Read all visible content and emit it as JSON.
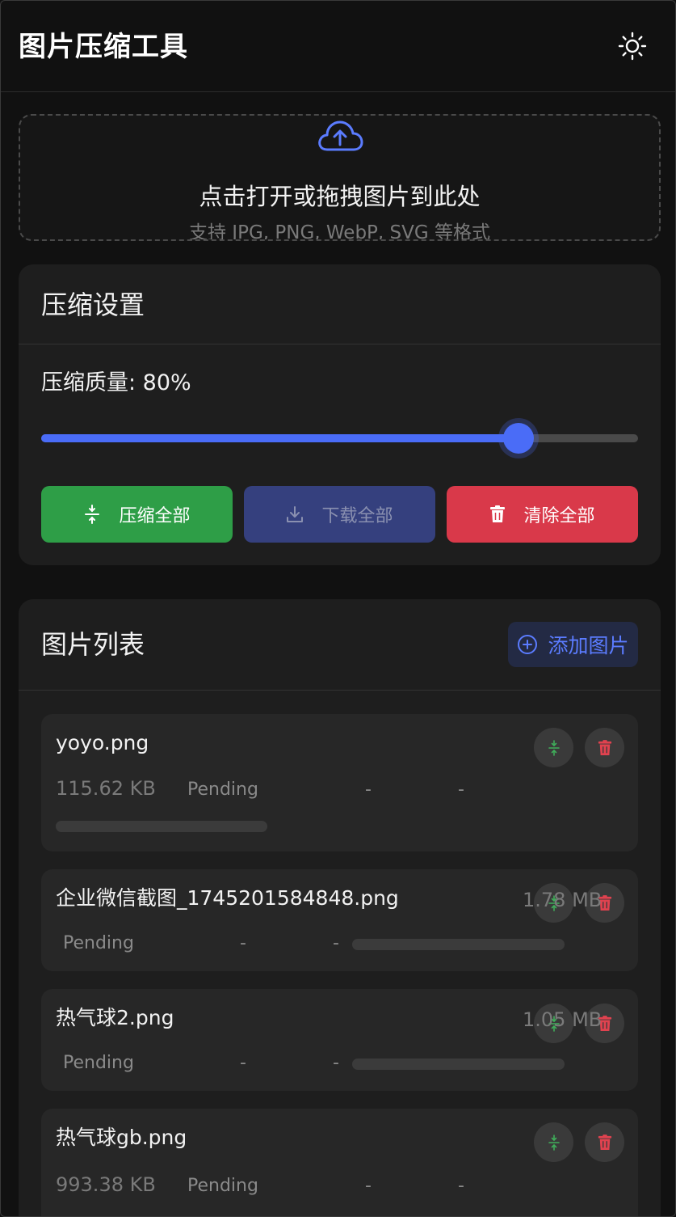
{
  "app": {
    "title": "图片压缩工具"
  },
  "upload": {
    "title": "点击打开或拖拽图片到此处",
    "subtitle": "支持 JPG, PNG, WebP, SVG 等格式"
  },
  "settings": {
    "title": "压缩设置",
    "quality_label": "压缩质量: 80%",
    "quality": 0.8,
    "compress_all": "压缩全部",
    "download_all": "下载全部",
    "clear_all": "清除全部"
  },
  "list": {
    "title": "图片列表",
    "add_label": "添加图片",
    "items": [
      {
        "name": "yoyo.png",
        "size": "115.62 KB",
        "status": "Pending",
        "compressed_size": "-",
        "ratio": "-",
        "progress": 0
      },
      {
        "name": "企业微信截图_1745201584848.png",
        "size": "1.78 MB",
        "status": "Pending",
        "compressed_size": "-",
        "ratio": "-",
        "progress": 0
      },
      {
        "name": "热气球2.png",
        "size": "1.05 MB",
        "status": "Pending",
        "compressed_size": "-",
        "ratio": "-",
        "progress": 0
      },
      {
        "name": "热气球gb.png",
        "size": "993.38 KB",
        "status": "Pending",
        "compressed_size": "-",
        "ratio": "-",
        "progress": 0
      }
    ]
  },
  "colors": {
    "background": "#111111",
    "card": "#1e1e1e",
    "accent": "#4a6cf7",
    "success": "#2e9e47",
    "danger": "#d9394a"
  },
  "icons": {
    "theme": "sun-icon",
    "upload": "cloud-upload-icon",
    "compress": "compress-icon",
    "download": "download-icon",
    "clear": "trash-icon",
    "add": "plus-circle-icon"
  }
}
